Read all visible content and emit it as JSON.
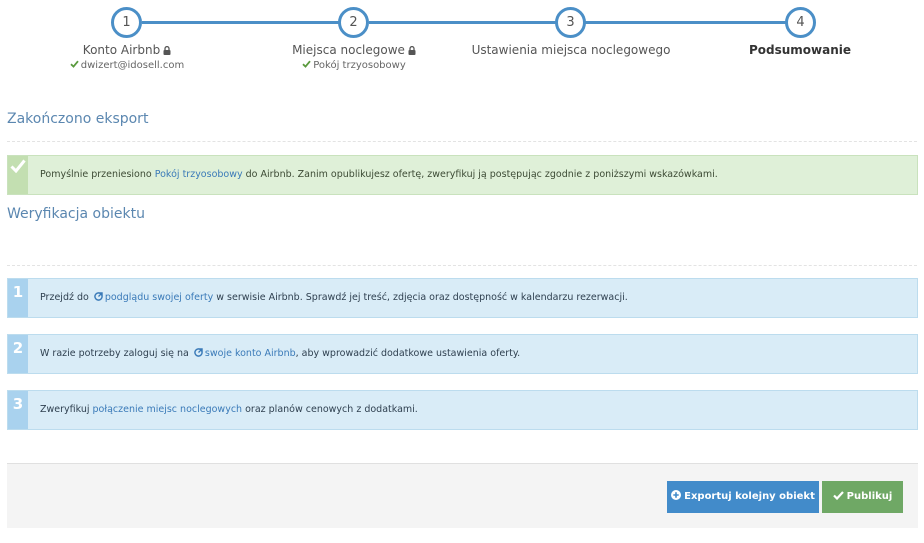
{
  "stepper": {
    "steps": [
      {
        "number": "1",
        "title": "Konto Airbnb",
        "subtitle": "dwizert@idosell.com",
        "locked": true
      },
      {
        "number": "2",
        "title": "Miejsca noclegowe",
        "subtitle": "Pokój trzyosobowy",
        "locked": true
      },
      {
        "number": "3",
        "title": "Ustawienia miejsca noclegowego",
        "subtitle": ""
      },
      {
        "number": "4",
        "title": "Podsumowanie",
        "subtitle": ""
      }
    ]
  },
  "export_section": {
    "title": "Zakończono eksport",
    "alert": {
      "text_before": "Pomyślnie przeniesiono ",
      "link": "Pokój trzyosobowy",
      "text_after": " do Airbnb. Zanim opublikujesz ofertę, zweryfikuj ją postępując zgodnie z poniższymi wskazówkami."
    }
  },
  "verification_section": {
    "title": "Weryfikacja obiektu",
    "items": [
      {
        "number": "1",
        "before": "Przejdź do ",
        "link": "podglądu swojej oferty",
        "after": " w serwisie Airbnb. Sprawdź jej treść, zdjęcia oraz dostępność w kalendarzu rezerwacji."
      },
      {
        "number": "2",
        "before": "W razie potrzeby zaloguj się na ",
        "link": "swoje konto Airbnb",
        "after": ", aby wprowadzić dodatkowe ustawienia oferty."
      },
      {
        "number": "3",
        "before": "Zweryfikuj ",
        "link": "połączenie miejsc noclegowych",
        "after": " oraz planów cenowych z dodatkami."
      }
    ]
  },
  "footer": {
    "export_button": "Exportuj kolejny obiekt",
    "publish_button": "Publikuj"
  },
  "colors": {
    "accent": "#4b8fc7",
    "success": "#6fa865",
    "primary": "#428bca"
  }
}
